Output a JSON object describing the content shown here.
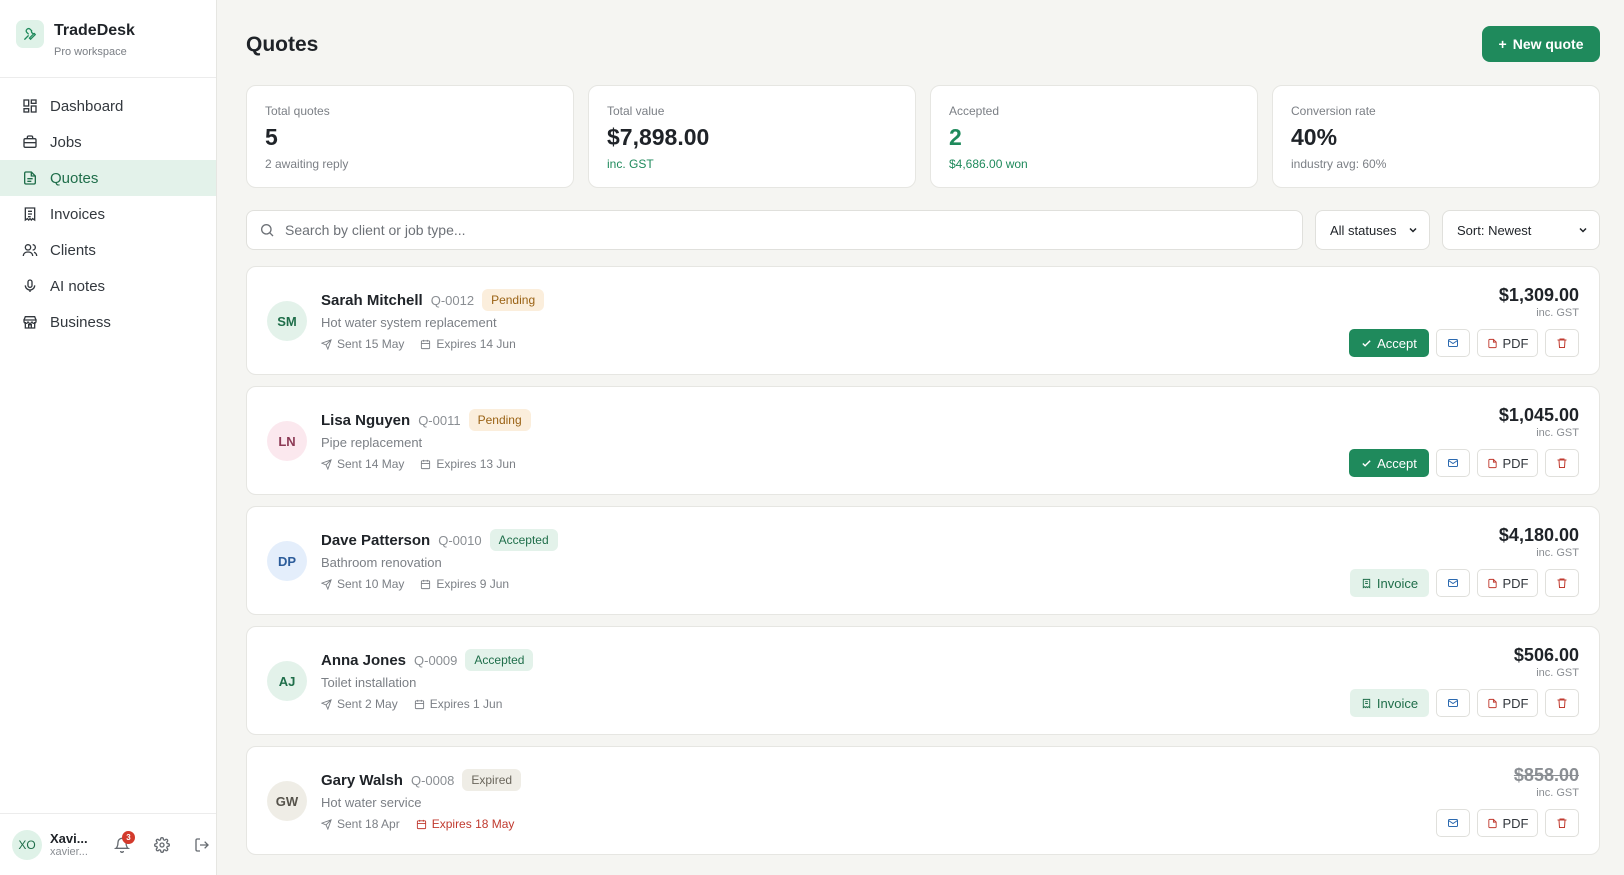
{
  "brand": {
    "name": "TradeDesk",
    "subtitle": "Pro workspace"
  },
  "sidebar": {
    "items": [
      {
        "label": "Dashboard",
        "icon": "dashboard-icon",
        "active": false
      },
      {
        "label": "Jobs",
        "icon": "briefcase-icon",
        "active": false
      },
      {
        "label": "Quotes",
        "icon": "document-icon",
        "active": true
      },
      {
        "label": "Invoices",
        "icon": "receipt-icon",
        "active": false
      },
      {
        "label": "Clients",
        "icon": "users-icon",
        "active": false
      },
      {
        "label": "AI notes",
        "icon": "microphone-icon",
        "active": false
      },
      {
        "label": "Business",
        "icon": "store-icon",
        "active": false
      }
    ],
    "user": {
      "initials": "XO",
      "name": "Xavi...",
      "email": "xavier...",
      "notifications": "3"
    }
  },
  "header": {
    "title": "Quotes",
    "new_button": "New quote"
  },
  "stats": [
    {
      "label": "Total quotes",
      "value": "5",
      "sub": "2 awaiting reply"
    },
    {
      "label": "Total value",
      "value": "$7,898.00",
      "sub": "inc. GST"
    },
    {
      "label": "Accepted",
      "value": "2",
      "sub": "$4,686.00 won"
    },
    {
      "label": "Conversion rate",
      "value": "40%",
      "sub": "industry avg: 60%"
    }
  ],
  "filters": {
    "search_placeholder": "Search by client or job type...",
    "status_value": "All statuses",
    "sort_value": "Sort: Newest"
  },
  "quotes": [
    {
      "initials": "SM",
      "name": "Sarah Mitchell",
      "number": "Q-0012",
      "status": "Pending",
      "job": "Hot water system replacement",
      "sent": "Sent 15 May",
      "expires": "Expires 14 Jun",
      "amount": "$1,309.00",
      "gst": "inc. GST",
      "primary_action": "Accept",
      "pdf": "PDF"
    },
    {
      "initials": "LN",
      "name": "Lisa Nguyen",
      "number": "Q-0011",
      "status": "Pending",
      "job": "Pipe replacement",
      "sent": "Sent 14 May",
      "expires": "Expires 13 Jun",
      "amount": "$1,045.00",
      "gst": "inc. GST",
      "primary_action": "Accept",
      "pdf": "PDF"
    },
    {
      "initials": "DP",
      "name": "Dave Patterson",
      "number": "Q-0010",
      "status": "Accepted",
      "job": "Bathroom renovation",
      "sent": "Sent 10 May",
      "expires": "Expires 9 Jun",
      "amount": "$4,180.00",
      "gst": "inc. GST",
      "primary_action": "Invoice",
      "pdf": "PDF"
    },
    {
      "initials": "AJ",
      "name": "Anna Jones",
      "number": "Q-0009",
      "status": "Accepted",
      "job": "Toilet installation",
      "sent": "Sent 2 May",
      "expires": "Expires 1 Jun",
      "amount": "$506.00",
      "gst": "inc. GST",
      "primary_action": "Invoice",
      "pdf": "PDF"
    },
    {
      "initials": "GW",
      "name": "Gary Walsh",
      "number": "Q-0008",
      "status": "Expired",
      "job": "Hot water service",
      "sent": "Sent 18 Apr",
      "expires": "Expires 18 May",
      "amount": "$858.00",
      "gst": "inc. GST",
      "primary_action": "",
      "pdf": "PDF"
    }
  ],
  "colors": {
    "accent": "#1f8a5c",
    "pending": "#9a6214",
    "expired": "#c03a2f"
  }
}
